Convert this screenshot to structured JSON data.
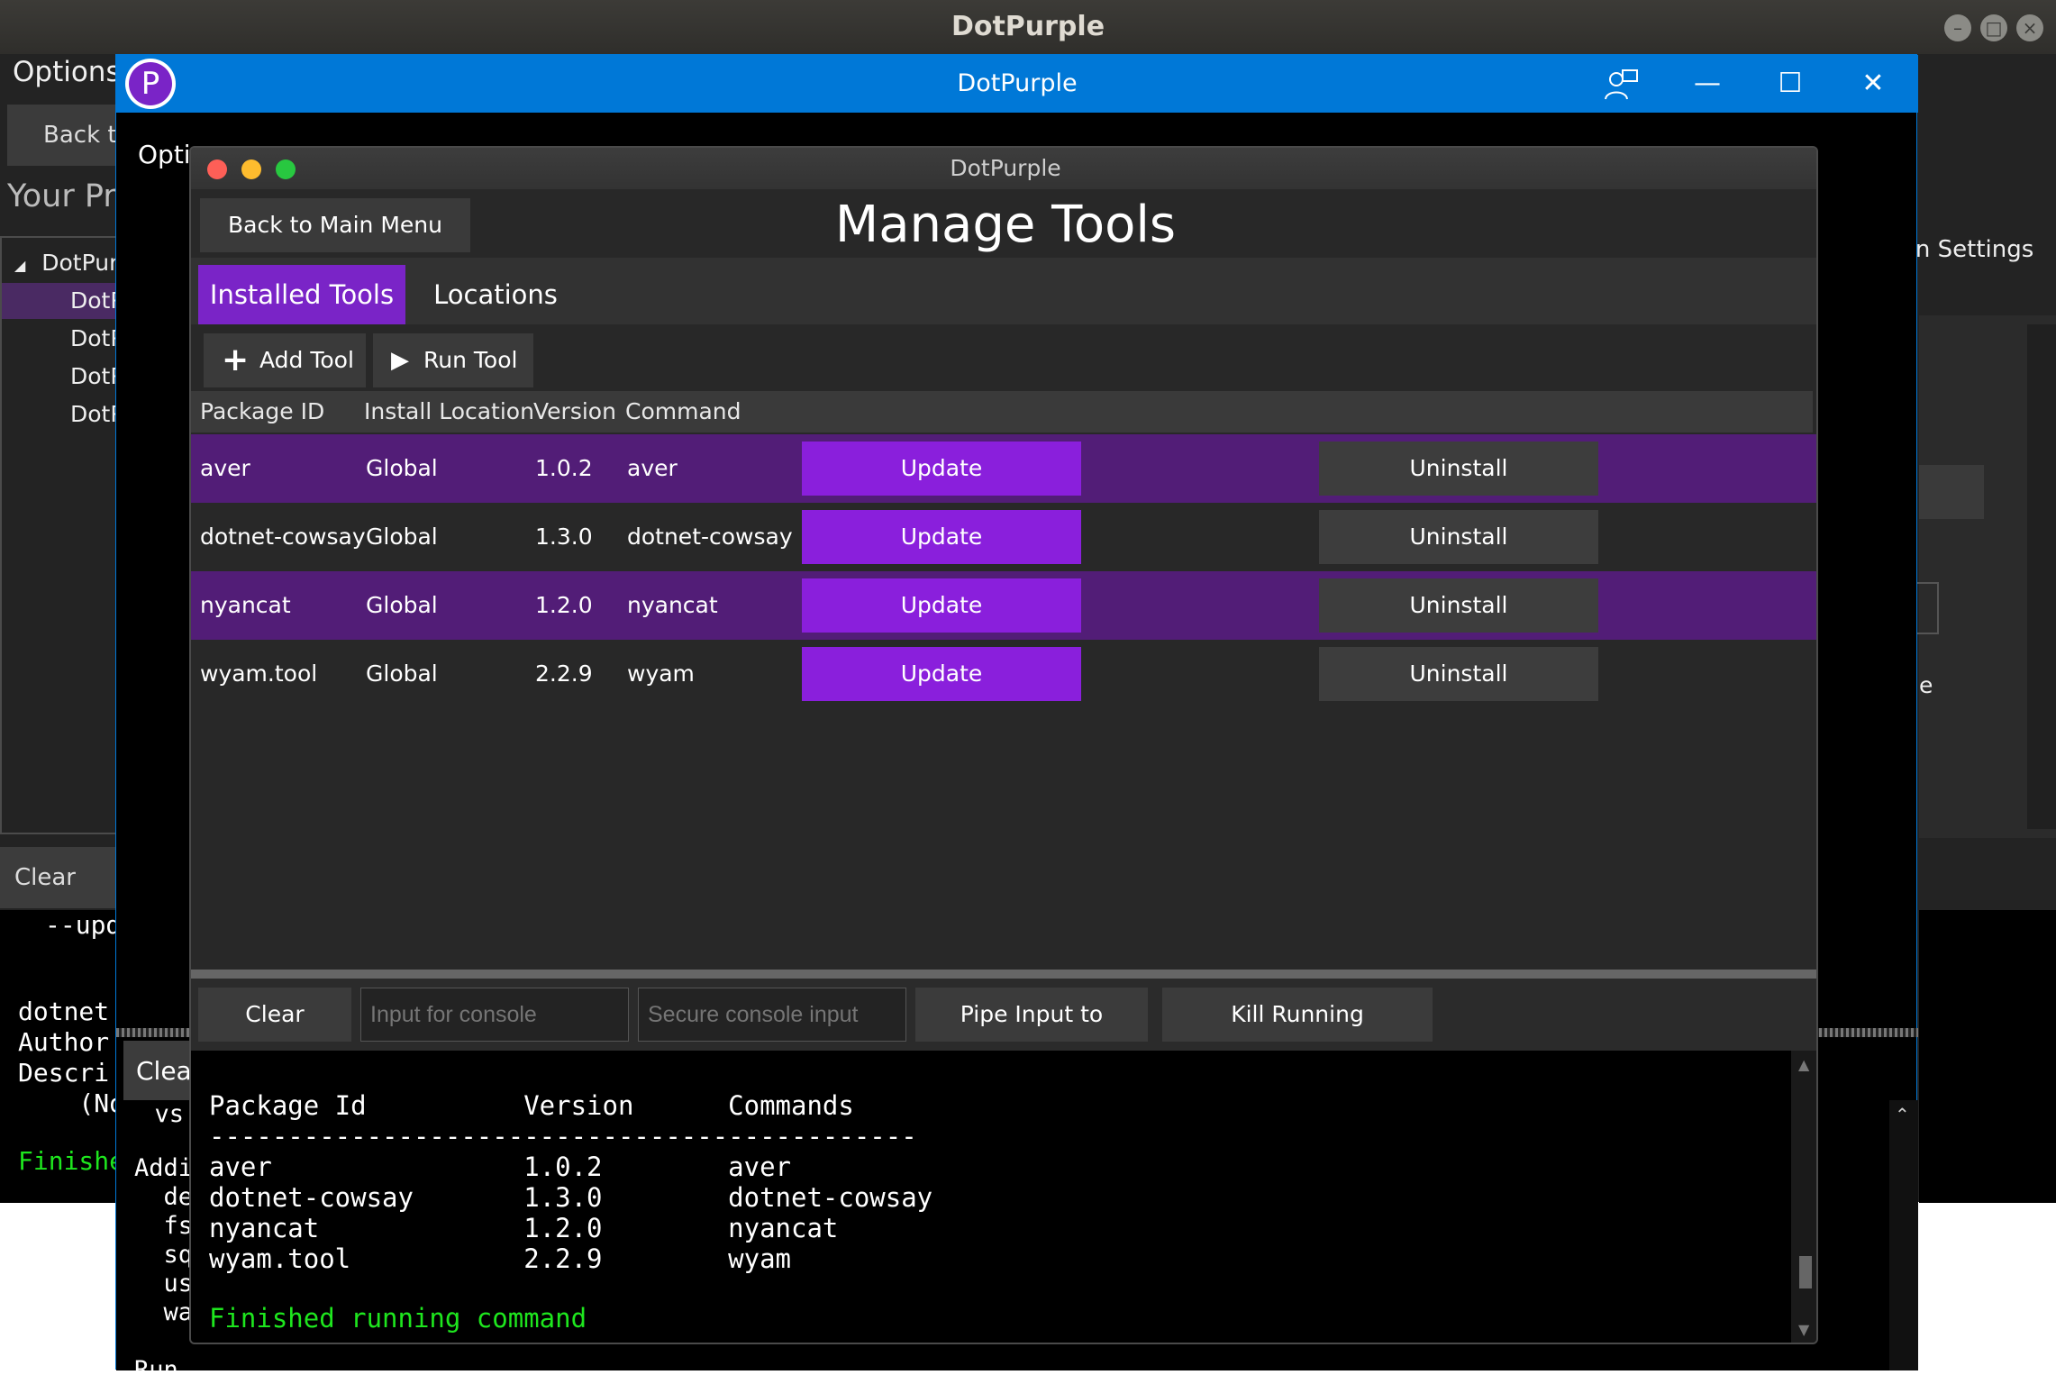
{
  "back_window": {
    "title": "DotPurple",
    "options_label": "Options",
    "back_label": "Back to",
    "your_projects": "Your Pro",
    "tree_root": "DotPur",
    "tree_items": [
      "DotP",
      "DotP",
      "DotP",
      "DotP"
    ],
    "right_settings": "on Settings",
    "right_label_e": "e",
    "clear_console": "Clear Con",
    "console_lines": [
      "--upd",
      "",
      "dotnet",
      "Author",
      "Descri",
      "    (No",
      "",
      "Finishe"
    ]
  },
  "mid_window": {
    "title": "DotPurple",
    "logo_letter": "P",
    "options_label": "Opti",
    "clear_label": "Clea",
    "console_lines": [
      "  vs",
      "",
      "Addi",
      "  de",
      "  fs",
      "  sq",
      "  us",
      "  wa",
      "",
      "Run"
    ]
  },
  "front_window": {
    "title": "DotPurple",
    "back_button": "Back to Main Menu",
    "heading": "Manage Tools",
    "tabs": {
      "installed": "Installed Tools",
      "locations": "Locations"
    },
    "toolbar": {
      "add_tool": "Add Tool",
      "run_tool": "Run Tool"
    },
    "columns": {
      "package_id": "Package ID",
      "install_location": "Install Location",
      "version": "Version",
      "command": "Command"
    },
    "update_label": "Update",
    "uninstall_label": "Uninstall",
    "rows": [
      {
        "package_id": "aver",
        "location": "Global",
        "version": "1.0.2",
        "command": "aver"
      },
      {
        "package_id": "dotnet-cowsay",
        "location": "Global",
        "version": "1.3.0",
        "command": "dotnet-cowsay"
      },
      {
        "package_id": "nyancat",
        "location": "Global",
        "version": "1.2.0",
        "command": "nyancat"
      },
      {
        "package_id": "wyam.tool",
        "location": "Global",
        "version": "2.2.9",
        "command": "wyam"
      }
    ],
    "console_bar": {
      "clear_console": "Clear Console",
      "input_placeholder": "Input for console",
      "secure_placeholder": "Secure console input",
      "pipe_input": "Pipe Input to Console",
      "kill": "Kill Running Command(s)"
    },
    "console": {
      "header": "Package Id          Version      Commands",
      "separator": "---------------------------------------------",
      "lines": [
        "aver                1.0.2        aver",
        "dotnet-cowsay       1.3.0        dotnet-cowsay",
        "nyancat             1.2.0        nyancat",
        "wyam.tool           2.2.9        wyam"
      ],
      "finished": "Finished running command"
    }
  },
  "colors": {
    "accent": "#7a24c7",
    "update_button": "#8a1fdc",
    "row_highlight": "#521d77",
    "titlebar_blue": "#0078d7",
    "console_green": "#1ee61e"
  }
}
